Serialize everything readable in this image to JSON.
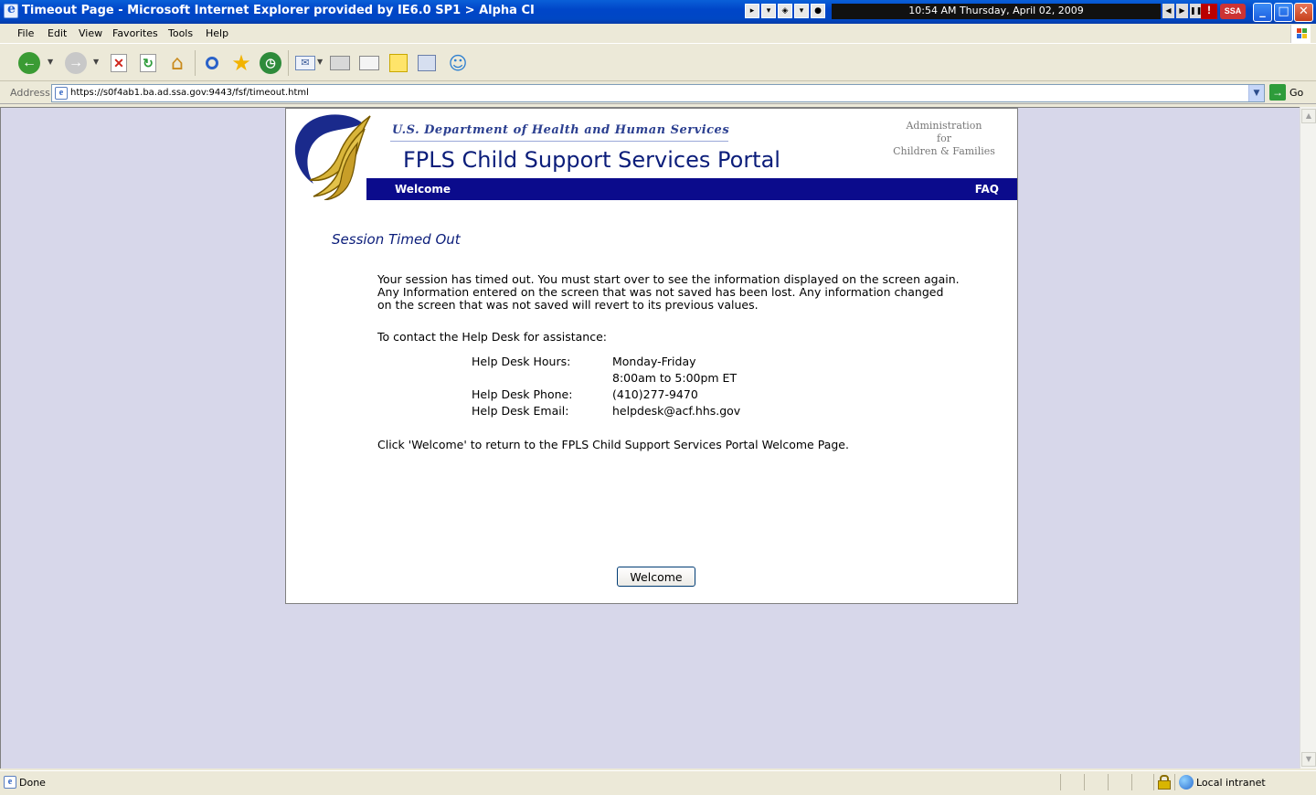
{
  "window": {
    "title": "Timeout Page - Microsoft Internet Explorer provided by IE6.0 SP1 > Alpha CI",
    "clock": "10:54 AM Thursday, April 02, 2009",
    "badge": "SSA",
    "controls": {
      "minimize": "_",
      "maximize": "□",
      "close": "✕"
    }
  },
  "menu": {
    "items": [
      "File",
      "Edit",
      "View",
      "Favorites",
      "Tools",
      "Help"
    ]
  },
  "toolbar": {
    "icons": [
      "back-icon",
      "forward-icon",
      "stop-icon",
      "refresh-icon",
      "home-icon",
      "search-icon",
      "favorites-icon",
      "history-icon",
      "mail-icon",
      "print-icon",
      "edit-icon",
      "discuss-icon",
      "research-icon",
      "messenger-icon"
    ]
  },
  "address": {
    "label": "Address",
    "url": "https://s0f4ab1.ba.ad.ssa.gov:9443/fsf/timeout.html",
    "go": "Go"
  },
  "header": {
    "department": "U.S. Department of Health and Human Services",
    "portal_title": "FPLS Child Support Services Portal",
    "acf_line1": "Administration",
    "acf_line2": "for",
    "acf_line3": "Children & Families",
    "nav_welcome": "Welcome",
    "nav_faq": "FAQ"
  },
  "content": {
    "heading": "Session Timed Out",
    "message_line1": "Your session has timed out. You must start over to see the information displayed on the screen again.",
    "message_line2": "Any Information entered on the screen that was not saved has been lost. Any information changed",
    "message_line3": "on the screen that was not saved will revert to its previous values.",
    "contact_intro": "To contact the Help Desk for assistance:",
    "hours_label": "Help Desk Hours:",
    "hours_value1": "Monday-Friday",
    "hours_value2": "8:00am to 5:00pm ET",
    "phone_label": "Help Desk Phone:",
    "phone_value": "(410)277-9470",
    "email_label": "Help Desk Email:",
    "email_value": "helpdesk@acf.hhs.gov",
    "return_message": "Click 'Welcome' to return to the FPLS Child Support Services Portal Welcome Page.",
    "welcome_button": "Welcome"
  },
  "status": {
    "text": "Done",
    "zone": "Local intranet"
  },
  "colors": {
    "titlebar": "#0046c8",
    "nav_band": "#0b0b8c",
    "title_text": "#0b1d7a",
    "page_background": "#d7d7ea"
  }
}
